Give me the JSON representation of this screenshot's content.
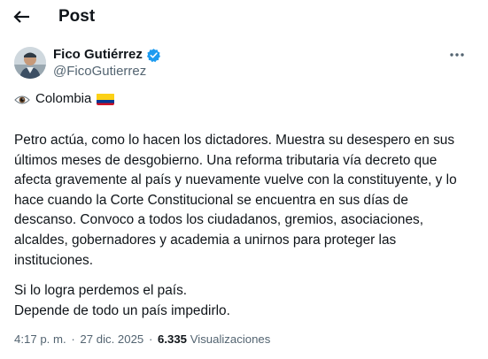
{
  "header": {
    "title": "Post"
  },
  "author": {
    "name": "Fico Gutiérrez",
    "handle": "@FicoGutierrez",
    "verified": true
  },
  "post": {
    "location_line": "Colombia",
    "paragraph_1_lines": [
      "Petro actúa, como lo hacen los dictadores. Muestra su desespero en sus",
      "últimos meses de desgobierno. Una reforma tributaria vía decreto que",
      "afecta gravemente al país y nuevamente vuelve con la constituyente, y lo",
      "hace cuando la Corte Constitucional se encuentra en sus días de",
      "descanso. Convoco a todos los ciudadanos, gremios, asociaciones,",
      "alcaldes, gobernadores y academia a unirnos para proteger las",
      "instituciones."
    ],
    "paragraph_2_lines": [
      "Si lo logra perdemos el país.",
      "Depende de todo un país impedirlo."
    ]
  },
  "meta": {
    "time": "4:17 p. m.",
    "separator": "·",
    "date": "27 dic. 2025",
    "views_count": "6.335",
    "views_label": "Visualizaciones"
  },
  "colors": {
    "text": "#0f1419",
    "secondary": "#536471",
    "verified_blue": "#1d9bf0"
  }
}
